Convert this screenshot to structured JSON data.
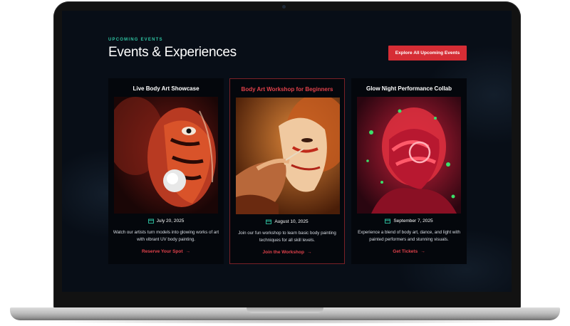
{
  "header": {
    "eyebrow": "UPCOMING EVENTS",
    "title": "Events & Experiences",
    "cta_label": "Explore All Upcoming Events"
  },
  "colors": {
    "accent": "#d62d35",
    "eyebrow": "#2fc4a3",
    "background": "#080e17"
  },
  "events": [
    {
      "title": "Live Body Art Showcase",
      "date": "July 20, 2025",
      "description": "Watch our artists turn models into glowing works of art with vibrant UV body painting.",
      "link": "Reserve Your Spot",
      "icon": "calendar-icon"
    },
    {
      "title": "Body Art Workshop for Beginners",
      "date": "August 10, 2025",
      "description": "Join our fun workshop to learn basic body painting techniques for all skill levels.",
      "link": "Join the Workshop",
      "icon": "calendar-icon"
    },
    {
      "title": "Glow Night Performance Collab",
      "date": "September 7, 2025",
      "description": "Experience a blend of body art, dance, and light with painted performers and stunning visuals.",
      "link": "Get Tickets",
      "icon": "calendar-icon"
    }
  ]
}
